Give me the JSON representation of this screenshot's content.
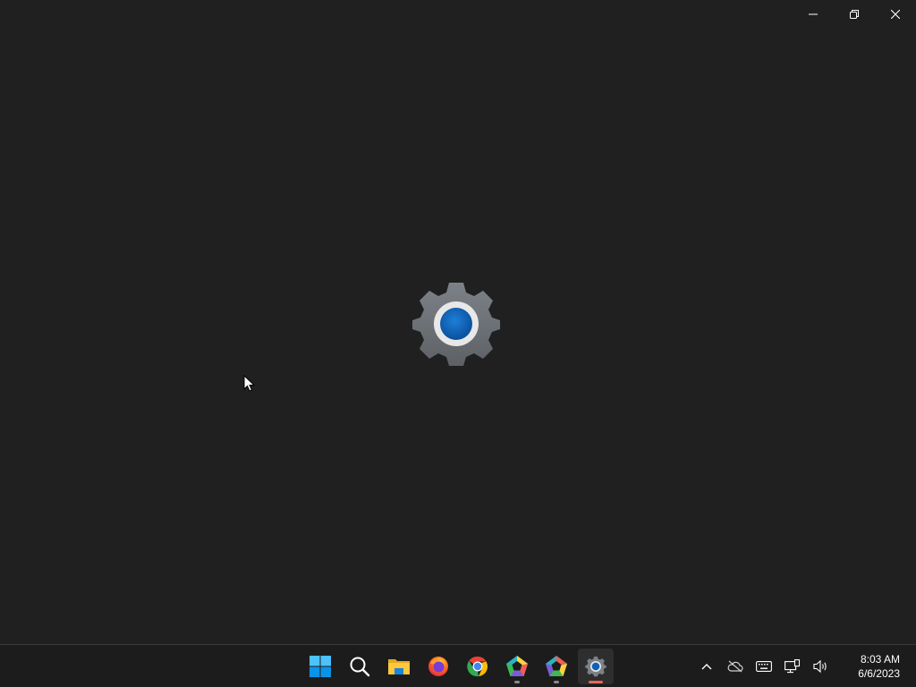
{
  "window": {
    "caption": {
      "minimize_icon": "minimize-icon",
      "maximize_icon": "restore-icon",
      "close_icon": "close-icon"
    },
    "splash_icon": "settings-gear-icon"
  },
  "taskbar": {
    "apps": [
      {
        "name": "start",
        "icon": "windows-start-icon",
        "running": false
      },
      {
        "name": "search",
        "icon": "search-icon",
        "running": false
      },
      {
        "name": "file-explorer",
        "icon": "folder-icon",
        "running": false
      },
      {
        "name": "firefox",
        "icon": "firefox-icon",
        "running": false
      },
      {
        "name": "chrome",
        "icon": "chrome-icon",
        "running": false
      },
      {
        "name": "app-pentagon-1",
        "icon": "pentagon-app-icon",
        "running": true
      },
      {
        "name": "app-pentagon-2",
        "icon": "pentagon-app-icon",
        "running": true
      },
      {
        "name": "settings",
        "icon": "settings-gear-icon",
        "running": true,
        "active": true
      }
    ],
    "tray": {
      "icons": [
        "chevron-up-icon",
        "onedrive-offline-icon",
        "keyboard-icon",
        "network-icon",
        "volume-icon"
      ],
      "time": "8:03 AM",
      "date": "6/6/2023"
    },
    "colors": {
      "active_indicator": "#e8675a",
      "background": "#1c1c1c",
      "desktop": "#202020"
    }
  }
}
